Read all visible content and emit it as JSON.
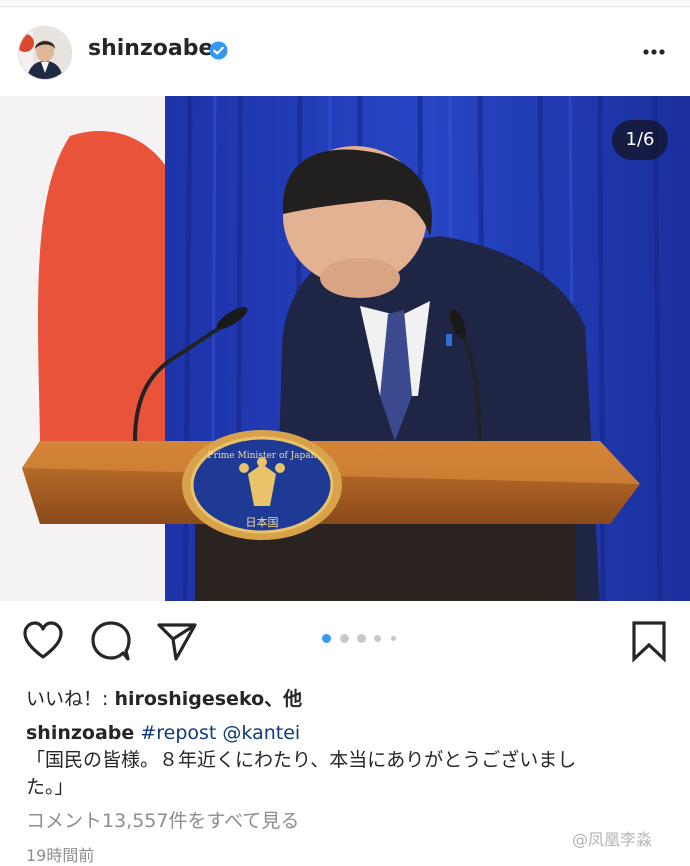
{
  "post": {
    "username": "shinzoabe",
    "verified_icon": "verified-badge-icon",
    "more_icon": "more-options-icon",
    "carousel_counter": "1/6",
    "carousel": {
      "current": 1,
      "total": 6,
      "dots_visible": 5
    },
    "photo": {
      "podium_seal_text": "Prime Minister of Japan",
      "podium_seal_kanji": "日本国"
    },
    "actions": {
      "like_icon": "heart-icon",
      "comment_icon": "comment-icon",
      "share_icon": "send-icon",
      "save_icon": "bookmark-icon"
    },
    "likes_prefix": "いいね！: ",
    "likes_user": "hiroshigeseko",
    "likes_suffix": "、他",
    "caption_user": "shinzoabe",
    "caption_tags": "#repost @kantei",
    "caption_line1": "「国民の皆様。８年近くにわたり、本当にありがとうございまし",
    "caption_line2": "た。」",
    "view_comments": "コメント13,557件をすべて見る",
    "timestamp": "19時間前"
  },
  "watermark": "@凤凰李淼",
  "colors": {
    "accent": "#3897f0",
    "tag": "#0f3a79",
    "muted": "#8e8e8e"
  }
}
